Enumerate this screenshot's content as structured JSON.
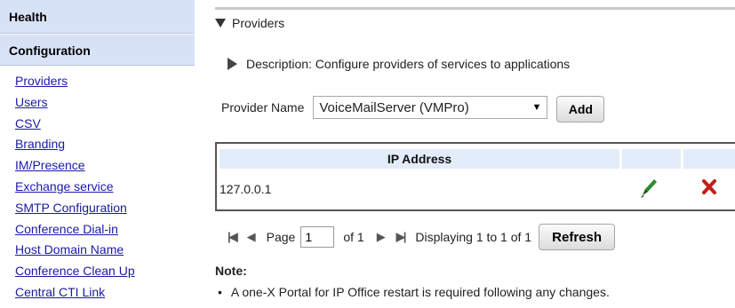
{
  "sidebar": {
    "health_label": "Health",
    "configuration_label": "Configuration",
    "links": [
      "Providers",
      "Users",
      "CSV",
      "Branding",
      "IM/Presence",
      "Exchange service",
      "SMTP Configuration",
      "Conference Dial-in",
      "Host Domain Name",
      "Conference Clean Up",
      "Central CTI Link"
    ]
  },
  "main": {
    "section_title": "Providers",
    "description": "Description: Configure providers of services to applications",
    "provider_name_label": "Provider Name",
    "provider_select_value": "VoiceMailServer (VMPro)",
    "add_button": "Add",
    "table": {
      "column_header": "IP Address",
      "rows": [
        {
          "ip": "127.0.0.1"
        }
      ]
    },
    "pager": {
      "page_label": "Page",
      "page_value": "1",
      "of_label": "of 1",
      "displaying": "Displaying 1 to 1 of 1",
      "refresh_button": "Refresh"
    },
    "note_label": "Note:",
    "note_text": "A one-X Portal for IP Office restart is required following any changes."
  },
  "colors": {
    "sidebar_header_bg": "#d8e2f6",
    "link_color": "#1a1aa6",
    "table_header_bg": "#e3ecfa",
    "edit_icon_green": "#2e8b2e",
    "delete_icon_red": "#c0201a"
  }
}
